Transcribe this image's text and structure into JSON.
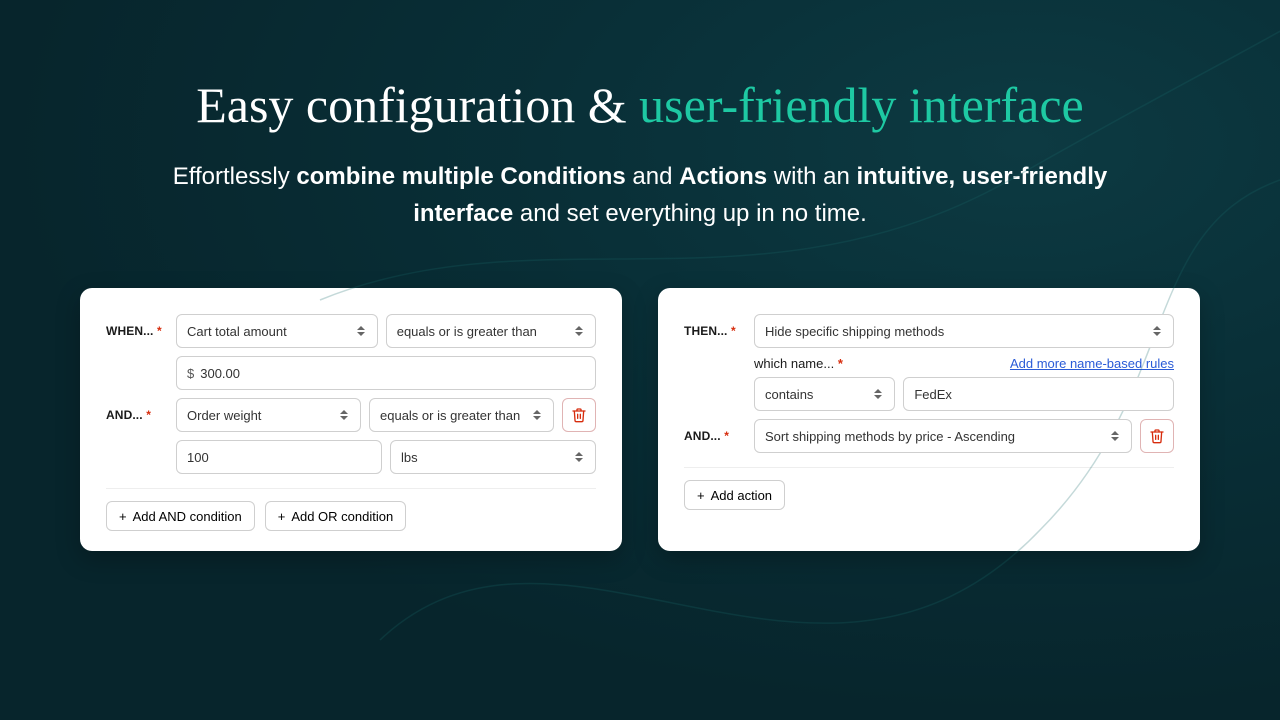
{
  "heading": {
    "plain": "Easy configuration & ",
    "accent": "user-friendly interface"
  },
  "subhead": {
    "t0": "Effortlessly ",
    "b0": "combine multiple Conditions",
    "t1": " and ",
    "b1": "Actions",
    "t2": " with an ",
    "b2": "intuitive, user-friendly interface",
    "t3": " and set everything up in no time."
  },
  "labels": {
    "when": "WHEN...",
    "and": "AND...",
    "then": "THEN...",
    "whichName": "which name...",
    "asterisk": "*"
  },
  "left": {
    "cond1_field": "Cart total amount",
    "cond1_op": "equals or is greater than",
    "cond1_prefix": "$",
    "cond1_value": "300.00",
    "cond2_field": "Order weight",
    "cond2_op": "equals or is greater than",
    "cond2_value": "100",
    "cond2_unit": "lbs",
    "addAnd": "Add AND condition",
    "addOr": "Add OR condition"
  },
  "right": {
    "action1": "Hide specific shipping methods",
    "nameOp": "contains",
    "nameValue": "FedEx",
    "addMoreLink": "Add more name-based rules",
    "action2": "Sort shipping methods by price - Ascending",
    "addAction": "Add action"
  }
}
